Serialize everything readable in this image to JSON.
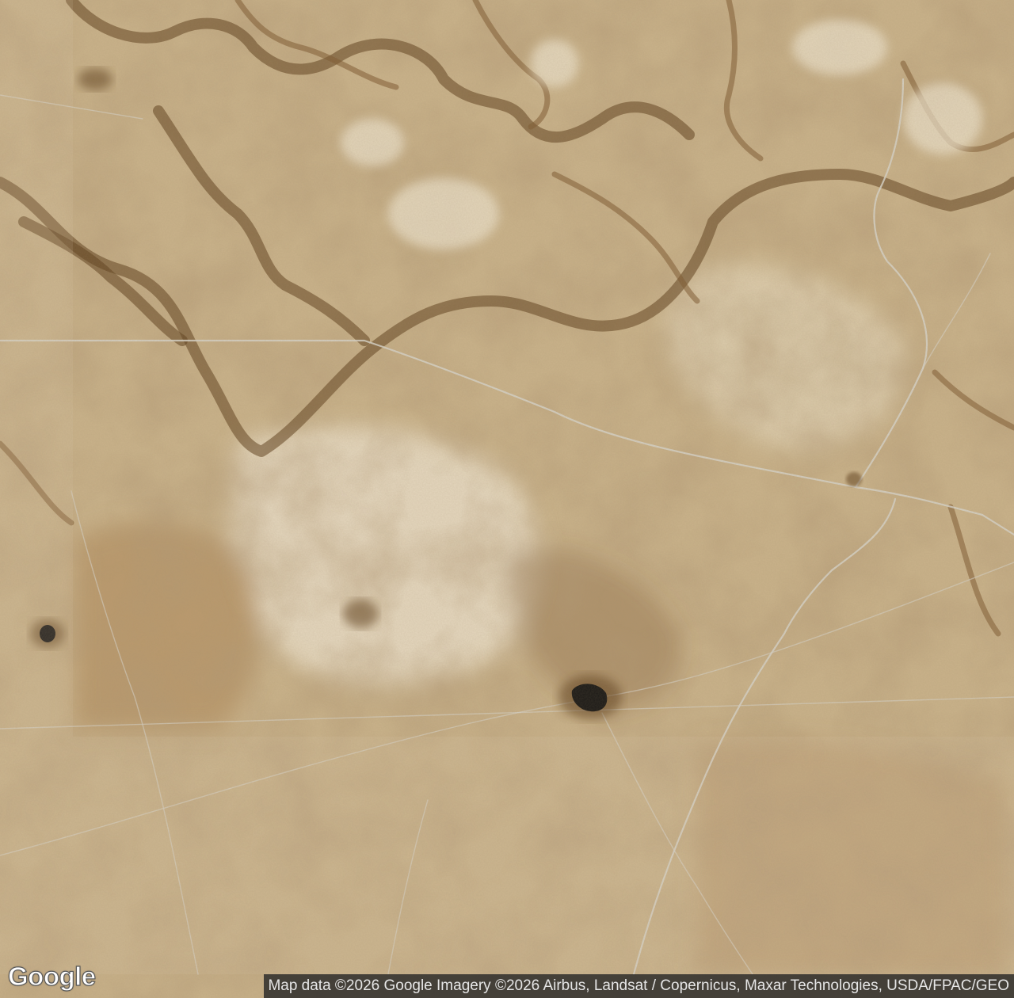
{
  "map": {
    "view": "satellite",
    "palette": {
      "base": "#c9b28a",
      "light": "#e0d1b3",
      "pale": "#ece2cd",
      "mid": "#b39063",
      "dark": "#7d5a31",
      "darker": "#5e3f1e",
      "road": "#d6d2c8",
      "water": "#1c1a17"
    }
  },
  "branding": {
    "logo_text": "Google"
  },
  "attribution": {
    "text": "Map data ©2026 Google Imagery ©2026 Airbus, Landsat / Copernicus, Maxar Technologies, USDA/FPAC/GEO"
  }
}
